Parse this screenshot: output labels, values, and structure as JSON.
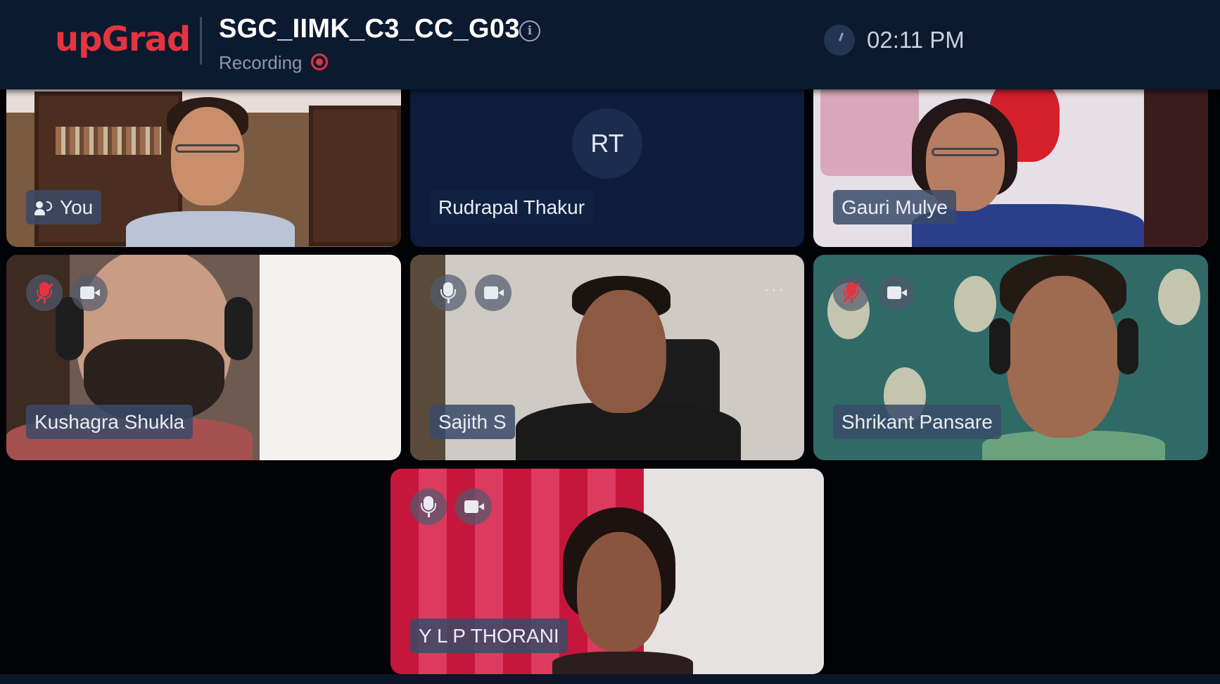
{
  "header": {
    "logo": "upGrad",
    "meeting_title": "SGC_IIMK_C3_CC_G03",
    "recording_label": "Recording",
    "time": "02:11 PM"
  },
  "participants": [
    {
      "name": "You",
      "icon": "speaker-icon"
    },
    {
      "name": "Rudrapal Thakur",
      "initials": "RT"
    },
    {
      "name": "Gauri Mulye"
    },
    {
      "name": "Kushagra Shukla",
      "mic": "muted",
      "camera": "on"
    },
    {
      "name": "Sajith S",
      "mic": "on",
      "camera": "on",
      "more": "···"
    },
    {
      "name": "Shrikant Pansare",
      "mic": "muted",
      "camera": "on"
    },
    {
      "name": "Y L P THORANI",
      "mic": "on",
      "camera": "on",
      "more": "···"
    }
  ],
  "colors": {
    "brand": "#e5343f",
    "header_bg": "#0c1a30",
    "page_bg": "#020307"
  }
}
